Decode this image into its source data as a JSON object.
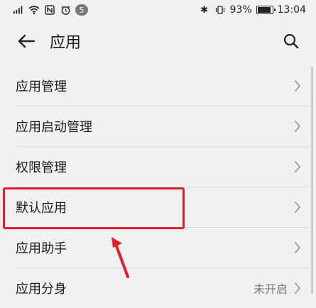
{
  "status_bar": {
    "left_signal": "\"ıll",
    "left_wifi": "wifi",
    "left_nfc": "N",
    "left_alarm": "alarm",
    "notification_badge": "5",
    "bluetooth": "✱",
    "vibrate": "vibrate",
    "battery_text": "93%",
    "battery_level": 0.93,
    "time": "13:04"
  },
  "app_bar": {
    "title": "应用"
  },
  "menu_items": [
    {
      "label": "应用管理",
      "value": ""
    },
    {
      "label": "应用启动管理",
      "value": ""
    },
    {
      "label": "权限管理",
      "value": ""
    },
    {
      "label": "默认应用",
      "value": ""
    },
    {
      "label": "应用助手",
      "value": ""
    },
    {
      "label": "应用分身",
      "value": "未开启"
    }
  ],
  "colors": {
    "background": "#f1f1f1",
    "highlight": "#e21f2a",
    "text": "#1a1a1a",
    "secondary_text": "#7a7a7a"
  }
}
